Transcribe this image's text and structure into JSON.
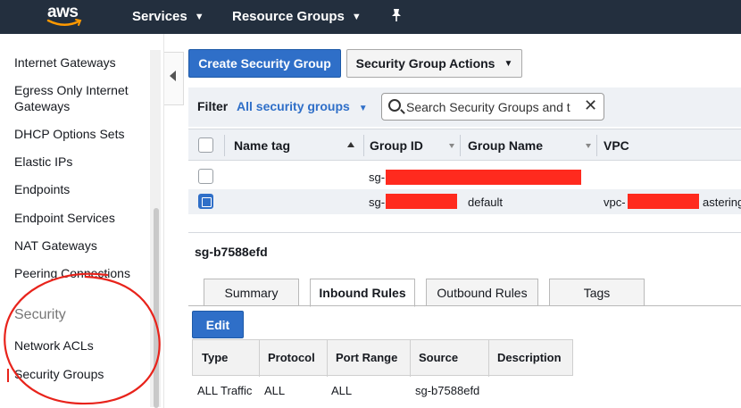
{
  "topnav": {
    "logo_text": "aws",
    "services_label": "Services",
    "resource_groups_label": "Resource Groups",
    "caret": "⌄",
    "pin_icon": "pushpin-icon"
  },
  "sidebar": {
    "items": [
      {
        "label": "Internet Gateways"
      },
      {
        "label": "Egress Only Internet Gateways"
      },
      {
        "label": "DHCP Options Sets"
      },
      {
        "label": "Elastic IPs"
      },
      {
        "label": "Endpoints"
      },
      {
        "label": "Endpoint Services"
      },
      {
        "label": "NAT Gateways"
      },
      {
        "label": "Peering Connections"
      }
    ],
    "security_heading": "Security",
    "security_items": [
      {
        "label": "Network ACLs"
      },
      {
        "label": "Security Groups"
      }
    ]
  },
  "toolbar": {
    "create_label": "Create Security Group",
    "actions_label": "Security Group Actions"
  },
  "filter": {
    "label": "Filter",
    "selected": "All security groups",
    "search_value": "Search Security Groups and t"
  },
  "grid": {
    "headers": [
      "Name tag",
      "Group ID",
      "Group Name",
      "VPC"
    ],
    "rows": [
      {
        "name_tag": "",
        "group_id": "sg-",
        "group_name": "",
        "vpc": "",
        "selected": false
      },
      {
        "name_tag": "",
        "group_id": "sg-",
        "group_name": "default",
        "vpc": "vpc-",
        "vpc_suffix": "astering_",
        "selected": true
      }
    ]
  },
  "detail": {
    "title": "sg-b7588efd",
    "tabs": [
      "Summary",
      "Inbound Rules",
      "Outbound Rules",
      "Tags"
    ],
    "active_tab": "Inbound Rules",
    "edit_label": "Edit",
    "rules_headers": [
      "Type",
      "Protocol",
      "Port Range",
      "Source",
      "Description"
    ],
    "rules_rows": [
      {
        "type": "ALL Traffic",
        "protocol": "ALL",
        "port_range": "ALL",
        "source": "sg-b7588efd",
        "description": ""
      }
    ]
  },
  "colors": {
    "nav_bg": "#232f3e",
    "primary_blue": "#2f6fc8",
    "annotation_red": "#e8231b",
    "redaction_red": "#ff2a1e"
  }
}
